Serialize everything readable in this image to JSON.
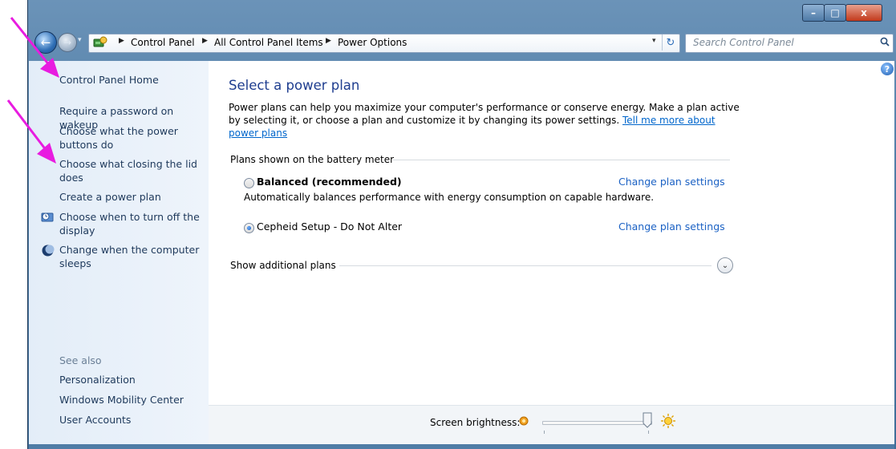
{
  "window": {
    "buttons": {
      "minimize": "–",
      "maximize": "□",
      "close": "x"
    }
  },
  "nav": {
    "back_glyph": "←",
    "forward_glyph": "→",
    "breadcrumbs": [
      "Control Panel",
      "All Control Panel Items",
      "Power Options"
    ],
    "arrow_glyph": "▶",
    "dropdown_glyph": "▾",
    "refresh_glyph": "↻"
  },
  "search": {
    "placeholder": "Search Control Panel"
  },
  "help": {
    "glyph": "?"
  },
  "sidebar": {
    "home": "Control Panel Home",
    "items": [
      {
        "label": "Require a password on wakeup",
        "icon": null
      },
      {
        "label": "Choose what the power buttons do",
        "icon": null
      },
      {
        "label": "Choose what closing the lid does",
        "icon": null
      },
      {
        "label": "Create a power plan",
        "icon": null
      },
      {
        "label": "Choose when to turn off the display",
        "icon": "display-timer-icon"
      },
      {
        "label": "Change when the computer sleeps",
        "icon": "moon-icon"
      }
    ],
    "see_also_title": "See also",
    "see_also": [
      "Personalization",
      "Windows Mobility Center",
      "User Accounts"
    ]
  },
  "main": {
    "title": "Select a power plan",
    "description": "Power plans can help you maximize your computer's performance or conserve energy. Make a plan active by selecting it, or choose a plan and customize it by changing its power settings.",
    "tell_more_link": "Tell me more about power plans",
    "plans_group_label": "Plans shown on the battery meter",
    "plans": [
      {
        "name": "Balanced (recommended)",
        "bold": true,
        "selected": false,
        "description": "Automatically balances performance with energy consumption on capable hardware.",
        "change_link": "Change plan settings"
      },
      {
        "name": "Cepheid Setup - Do Not Alter",
        "bold": false,
        "selected": true,
        "description": "",
        "change_link": "Change plan settings"
      }
    ],
    "show_more_label": "Show additional plans",
    "expand_glyph": "⌄"
  },
  "bottom": {
    "brightness_label": "Screen brightness:",
    "brightness_fraction": 0.93
  },
  "colors": {
    "link": "#1c62c4",
    "title": "#1e3d8f",
    "sidebar_text": "#1e395b",
    "annotation_arrow": "#e81ce0"
  }
}
